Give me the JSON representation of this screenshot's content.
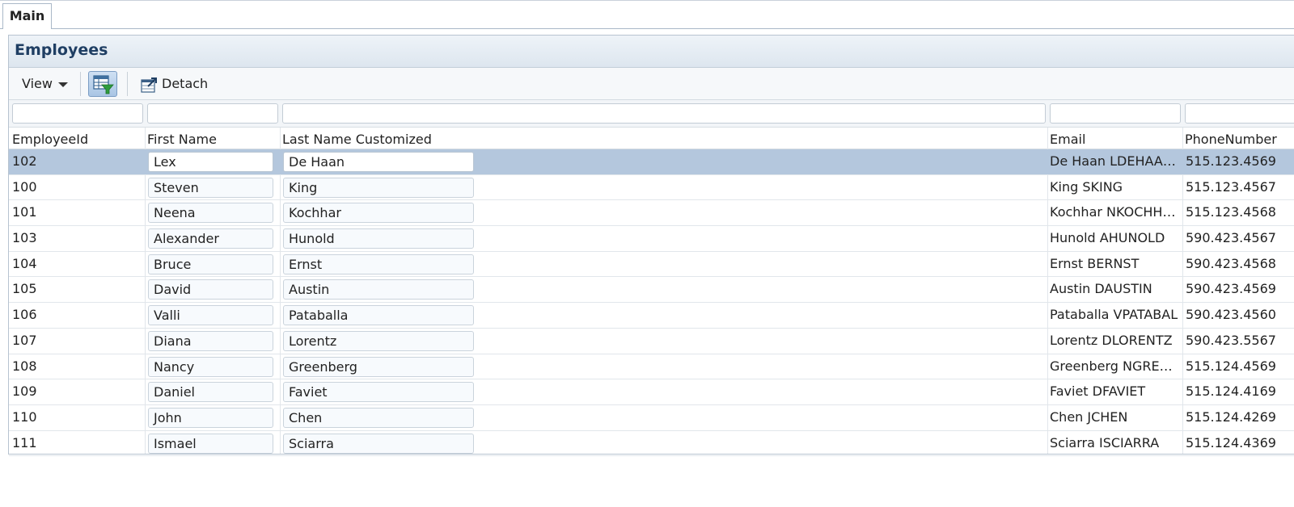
{
  "tabs": [
    {
      "label": "Main"
    }
  ],
  "panel": {
    "title": "Employees"
  },
  "toolbar": {
    "view_label": "View",
    "detach_label": "Detach"
  },
  "table": {
    "columns": [
      "EmployeeId",
      "First Name",
      "Last Name Customized",
      "Email",
      "PhoneNumber"
    ],
    "rows": [
      {
        "id": "102",
        "first": "Lex",
        "last": "De Haan",
        "email": "De Haan LDEHAAN...",
        "phone": "515.123.4569",
        "selected": true
      },
      {
        "id": "100",
        "first": "Steven",
        "last": "King",
        "email": "King SKING",
        "phone": "515.123.4567"
      },
      {
        "id": "101",
        "first": "Neena",
        "last": "Kochhar",
        "email": "Kochhar NKOCHHAR",
        "phone": "515.123.4568"
      },
      {
        "id": "103",
        "first": "Alexander",
        "last": "Hunold",
        "email": "Hunold AHUNOLD",
        "phone": "590.423.4567"
      },
      {
        "id": "104",
        "first": "Bruce",
        "last": "Ernst",
        "email": "Ernst BERNST",
        "phone": "590.423.4568"
      },
      {
        "id": "105",
        "first": "David",
        "last": "Austin",
        "email": "Austin DAUSTIN",
        "phone": "590.423.4569"
      },
      {
        "id": "106",
        "first": "Valli",
        "last": "Pataballa",
        "email": "Pataballa VPATABAL",
        "phone": "590.423.4560"
      },
      {
        "id": "107",
        "first": "Diana",
        "last": "Lorentz",
        "email": "Lorentz DLORENTZ",
        "phone": "590.423.5567"
      },
      {
        "id": "108",
        "first": "Nancy",
        "last": "Greenberg",
        "email": "Greenberg NGREE...",
        "phone": "515.124.4569"
      },
      {
        "id": "109",
        "first": "Daniel",
        "last": "Faviet",
        "email": "Faviet DFAVIET",
        "phone": "515.124.4169"
      },
      {
        "id": "110",
        "first": "John",
        "last": "Chen",
        "email": "Chen JCHEN",
        "phone": "515.124.4269"
      },
      {
        "id": "111",
        "first": "Ismael",
        "last": "Sciarra",
        "email": "Sciarra ISCIARRA",
        "phone": "515.124.4369"
      }
    ]
  }
}
